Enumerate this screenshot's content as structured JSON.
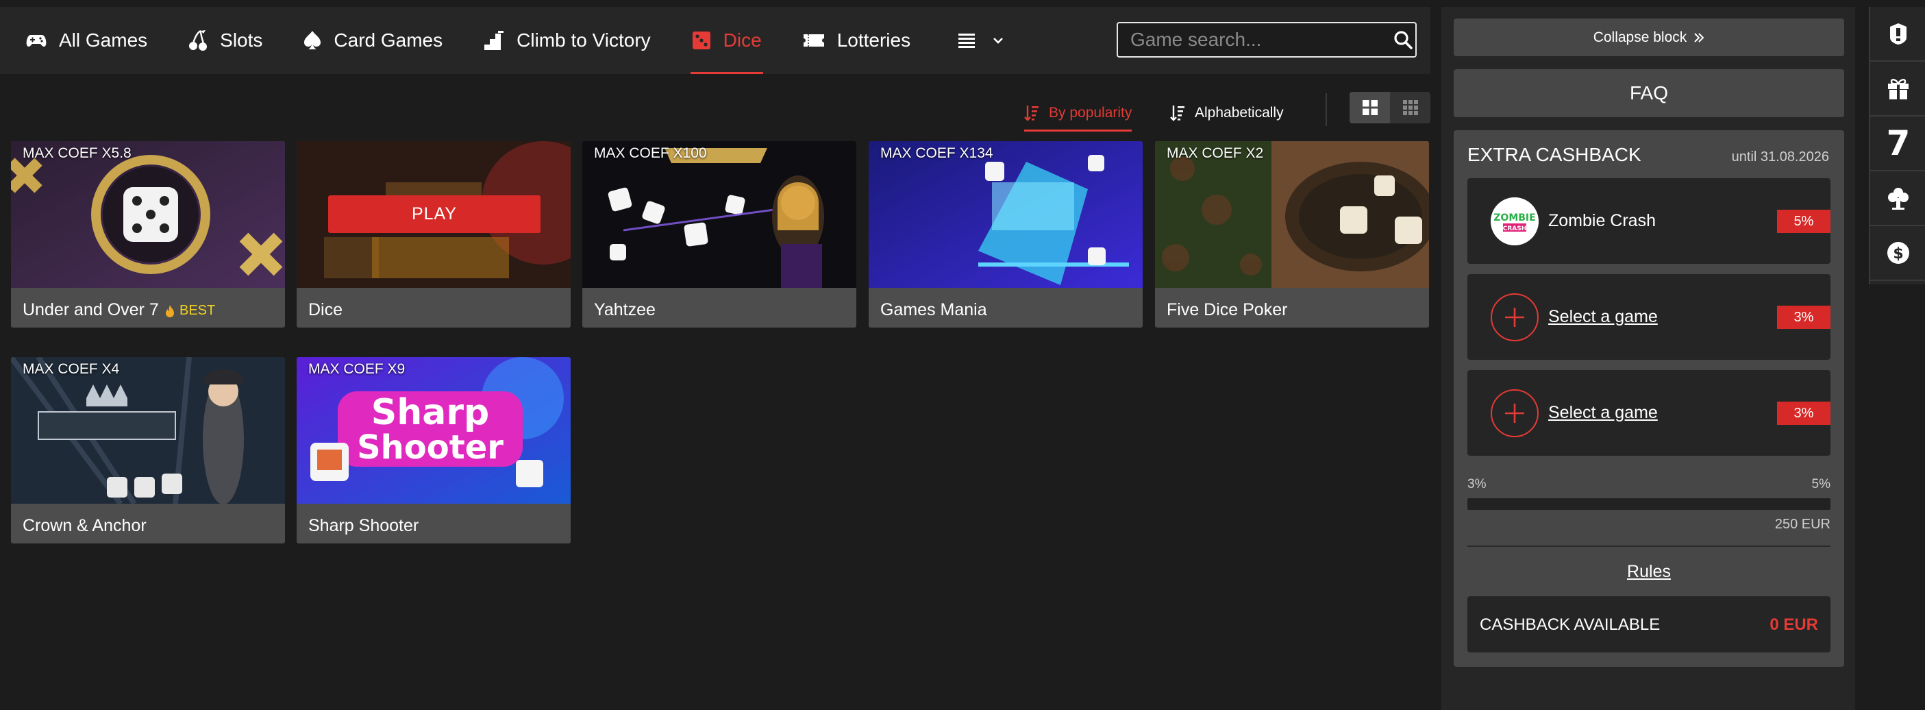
{
  "nav": {
    "items": [
      {
        "label": "All Games",
        "icon": "gamepad-icon"
      },
      {
        "label": "Slots",
        "icon": "cherry-icon"
      },
      {
        "label": "Card Games",
        "icon": "spade-icon"
      },
      {
        "label": "Climb to Victory",
        "icon": "stairs-icon"
      },
      {
        "label": "Dice",
        "icon": "dice-icon",
        "active": true
      },
      {
        "label": "Lotteries",
        "icon": "ticket-icon"
      }
    ],
    "search_placeholder": "Game search..."
  },
  "sort": {
    "by_popularity": "By popularity",
    "alphabetically": "Alphabetically",
    "active": "by_popularity"
  },
  "games": [
    {
      "title": "Under and Over 7",
      "coef": "MAX COEF X5.8",
      "badge": "BEST"
    },
    {
      "title": "Dice",
      "play_label": "PLAY"
    },
    {
      "title": "Yahtzee",
      "coef": "MAX COEF X100"
    },
    {
      "title": "Games Mania",
      "coef": "MAX COEF X134"
    },
    {
      "title": "Five Dice Poker",
      "coef": "MAX COEF X2"
    },
    {
      "title": "Crown & Anchor",
      "coef": "MAX COEF X4"
    },
    {
      "title": "Sharp Shooter",
      "coef": "MAX COEF X9"
    }
  ],
  "panel": {
    "collapse_label": "Collapse block",
    "faq_label": "FAQ",
    "cashback": {
      "title": "EXTRA CASHBACK",
      "until": "until 31.08.2026",
      "rows": [
        {
          "name": "Zombie Crash",
          "pct": "5%"
        },
        {
          "name": "Select a game",
          "pct": "3%"
        },
        {
          "name": "Select a game",
          "pct": "3%"
        }
      ],
      "range_min": "3%",
      "range_max": "5%",
      "progress": 0,
      "amount": "250 EUR",
      "rules_label": "Rules",
      "available_label": "CASHBACK AVAILABLE",
      "available_value": "0 EUR"
    }
  },
  "rail": {
    "items": [
      "promo-icon",
      "gift-icon",
      "seven-icon",
      "tree-icon",
      "dollar-icon"
    ],
    "seven_text": "7"
  },
  "colors": {
    "accent": "#e53a35",
    "background": "#1c1c1c",
    "card": "#4d4d4d",
    "panel": "#474747",
    "badge": "#f2d021"
  }
}
